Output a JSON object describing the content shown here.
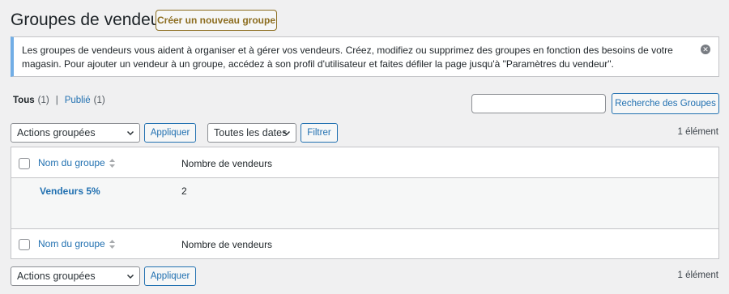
{
  "page": {
    "title": "Groupes de vendeurs",
    "add_new_label": "Créer un nouveau groupe"
  },
  "notice": {
    "text": "Les groupes de vendeurs vous aident à organiser et à gérer vos vendeurs. Créez, modifiez ou supprimez des groupes en fonction des besoins de votre magasin. Pour ajouter un vendeur à un groupe, accédez à son profil d'utilisateur et faites défiler la page jusqu'à \"Paramètres du vendeur\".",
    "dismiss_icon": "close-circle-icon"
  },
  "views": {
    "all_label": "Tous",
    "all_count": "(1)",
    "separator": "|",
    "published_label": "Publié",
    "published_count": "(1)"
  },
  "search": {
    "value": "",
    "button_label": "Recherche des Groupes"
  },
  "tablenav_top": {
    "bulk_actions": "Actions groupées",
    "apply_label": "Appliquer",
    "date_filter": "Toutes les dates",
    "filter_label": "Filtrer",
    "item_count": "1 élément"
  },
  "table": {
    "columns": [
      "Nom du groupe",
      "Nombre de vendeurs"
    ],
    "rows": [
      {
        "name": "Vendeurs 5%",
        "vendor_count": "2"
      }
    ]
  },
  "tablenav_bottom": {
    "bulk_actions": "Actions groupées",
    "apply_label": "Appliquer",
    "item_count": "1 élément"
  },
  "colors": {
    "link": "#2271b1",
    "accent_gold": "#8c6d1f",
    "notice_border": "#72aee6"
  }
}
